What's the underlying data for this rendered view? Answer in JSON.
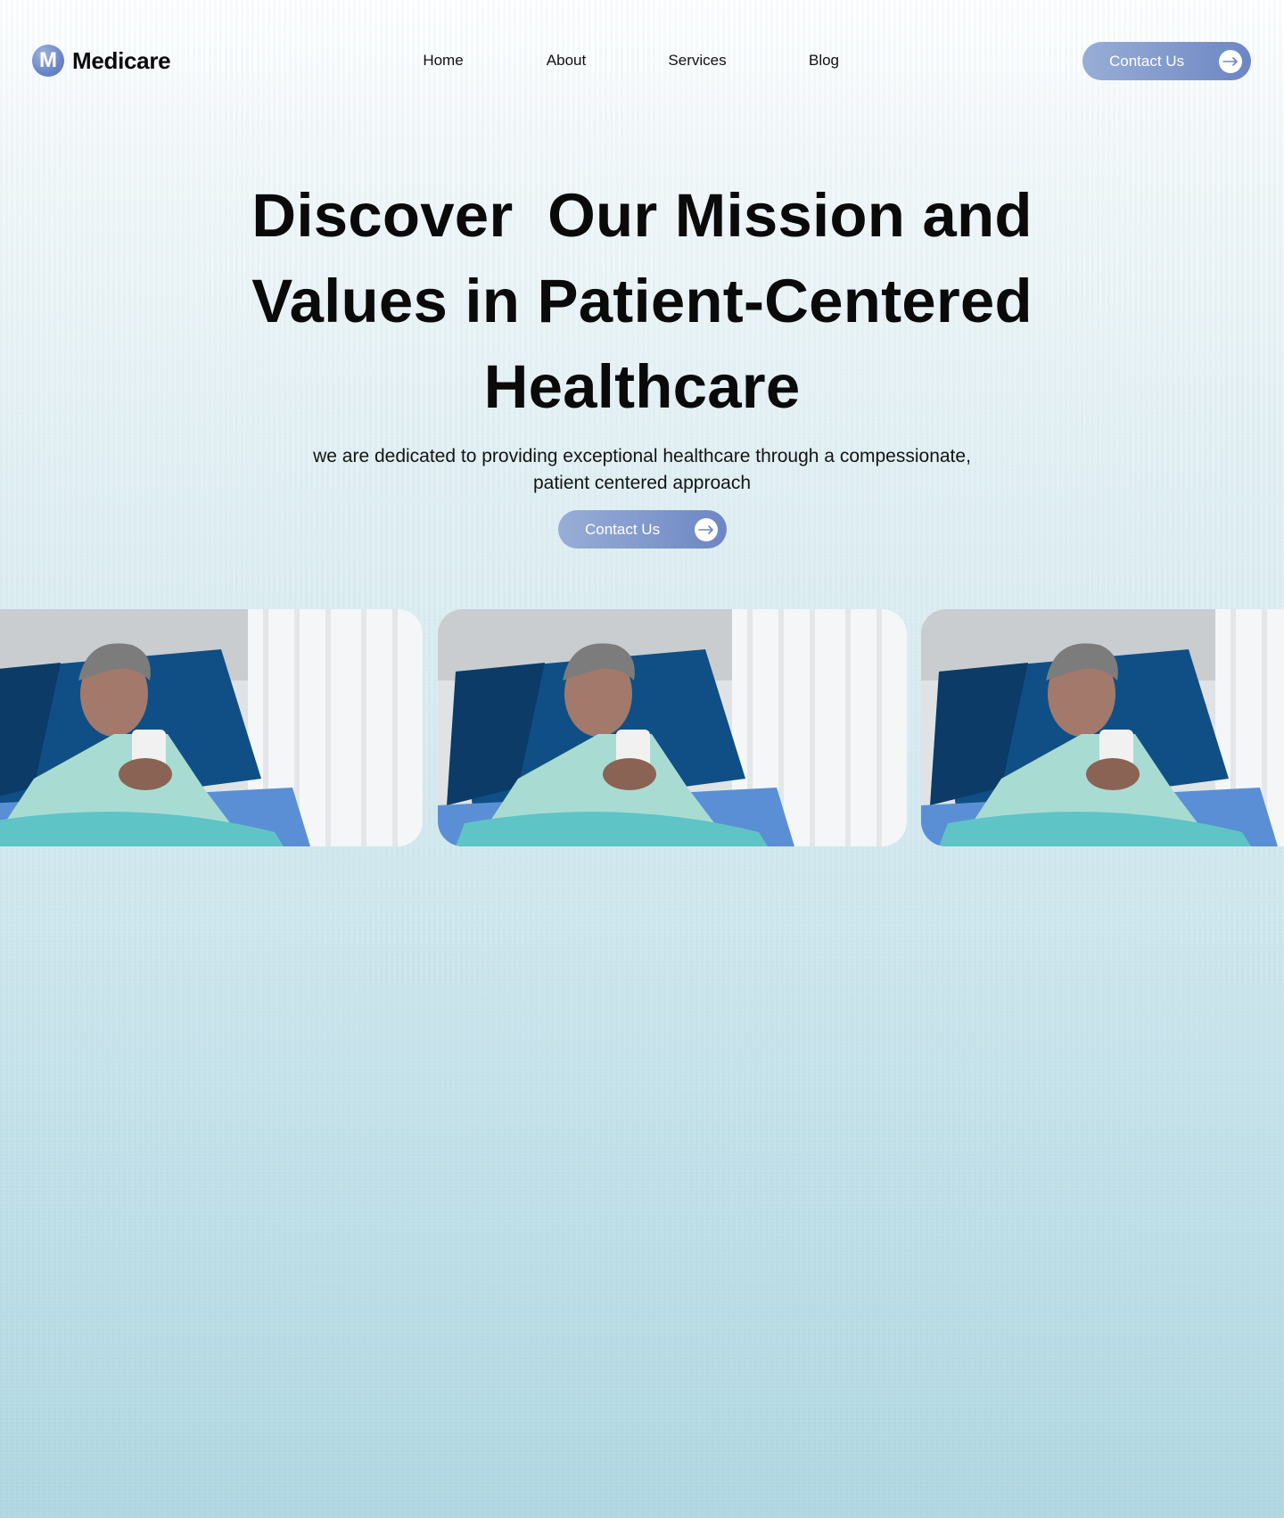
{
  "brand": {
    "logo_letter": "M",
    "name": "Medicare"
  },
  "nav": {
    "links": [
      "Home",
      "About",
      "Services",
      "Blog"
    ],
    "cta_label": "Contact Us"
  },
  "hero": {
    "title_lines": [
      "Discover  Our Mission and",
      "Values in Patient-Centered",
      "Healthcare"
    ],
    "subtitle_lines": [
      "we are dedicated to providing exceptional healthcare through a compessionate,",
      "patient centered approach"
    ],
    "cta_label": "Contact Us"
  },
  "gallery": {
    "images": [
      {
        "subject": "elderly patient in hospital bed holding a mug"
      },
      {
        "subject": "elderly patient in hospital bed holding a mug"
      },
      {
        "subject": "elderly patient in hospital bed holding a mug"
      }
    ]
  },
  "colors": {
    "accent_start": "#98aed6",
    "accent_end": "#6d86c4",
    "background_top": "#ffffff",
    "background_bottom": "#b0d7e2"
  }
}
